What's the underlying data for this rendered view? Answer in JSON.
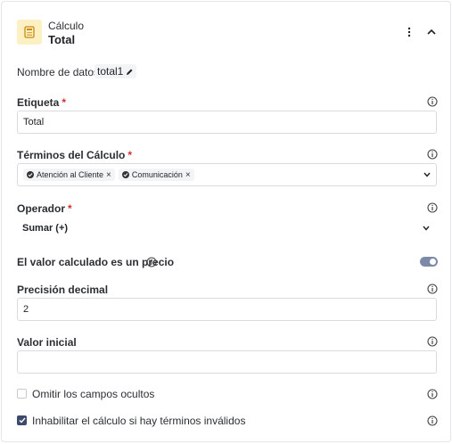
{
  "header": {
    "type_label": "Cálculo",
    "title": "Total"
  },
  "data_name": {
    "label": "Nombre de datos:",
    "value": "total1"
  },
  "label_field": {
    "label": "Etiqueta",
    "required": "*",
    "value": "Total"
  },
  "terms_field": {
    "label": "Términos del Cálculo",
    "required": "*",
    "tags": [
      "Atención al Cliente",
      "Comunicación"
    ]
  },
  "operator_field": {
    "label": "Operador",
    "required": "*",
    "value": "Sumar (+)"
  },
  "price_toggle": {
    "label": "El valor calculado es un precio",
    "on": true
  },
  "precision_field": {
    "label": "Precisión decimal",
    "value": "2"
  },
  "initial_field": {
    "label": "Valor inicial",
    "value": ""
  },
  "omit_hidden": {
    "label": "Omitir los campos ocultos",
    "checked": false
  },
  "disable_invalid": {
    "label": "Inhabilitar el cálculo si hay términos inválidos",
    "checked": true
  },
  "colors": {
    "accent": "#3d4a6b",
    "required": "#d32f2f",
    "icon_bg": "#fdf0c2",
    "toggle": "#7c8aa8"
  }
}
